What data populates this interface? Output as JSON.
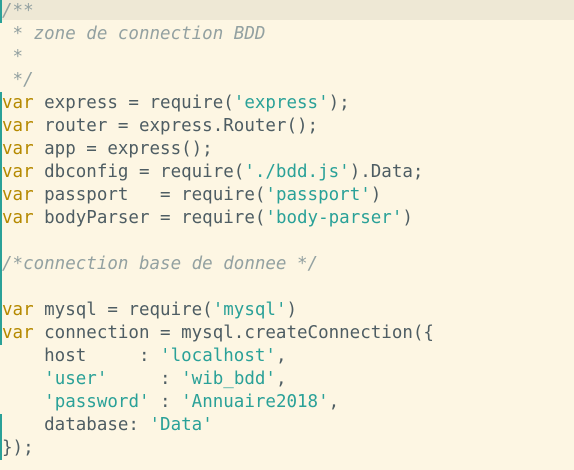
{
  "editor": {
    "theme_colors": {
      "background": "#fdf6e3",
      "keyword": "#b58900",
      "string": "#2aa198",
      "comment": "#93a1a1",
      "text": "#4e5d63"
    },
    "lines": [
      {
        "parts": [
          {
            "t": "cm",
            "v": "/**"
          }
        ]
      },
      {
        "parts": [
          {
            "t": "cm",
            "v": " * zone de connection BDD"
          }
        ]
      },
      {
        "parts": [
          {
            "t": "cm",
            "v": " *"
          }
        ]
      },
      {
        "parts": [
          {
            "t": "cm",
            "v": " */"
          }
        ]
      },
      {
        "parts": [
          {
            "t": "kw",
            "v": "var"
          },
          {
            "t": "plain",
            "v": " express = require("
          },
          {
            "t": "str",
            "v": "'express'"
          },
          {
            "t": "plain",
            "v": ");"
          }
        ]
      },
      {
        "parts": [
          {
            "t": "kw",
            "v": "var"
          },
          {
            "t": "plain",
            "v": " router = express.Router();"
          }
        ]
      },
      {
        "parts": [
          {
            "t": "kw",
            "v": "var"
          },
          {
            "t": "plain",
            "v": " app = express();"
          }
        ]
      },
      {
        "parts": [
          {
            "t": "kw",
            "v": "var"
          },
          {
            "t": "plain",
            "v": " dbconfig = require("
          },
          {
            "t": "str",
            "v": "'./bdd.js'"
          },
          {
            "t": "plain",
            "v": ").Data;"
          }
        ]
      },
      {
        "parts": [
          {
            "t": "kw",
            "v": "var"
          },
          {
            "t": "plain",
            "v": " passport   = require("
          },
          {
            "t": "str",
            "v": "'passport'"
          },
          {
            "t": "plain",
            "v": ")"
          }
        ]
      },
      {
        "parts": [
          {
            "t": "kw",
            "v": "var"
          },
          {
            "t": "plain",
            "v": " bodyParser = require("
          },
          {
            "t": "str",
            "v": "'body-parser'"
          },
          {
            "t": "plain",
            "v": ")"
          }
        ]
      },
      {
        "parts": []
      },
      {
        "parts": [
          {
            "t": "cm",
            "v": "/*connection base de donnee */"
          }
        ]
      },
      {
        "parts": []
      },
      {
        "parts": [
          {
            "t": "kw",
            "v": "var"
          },
          {
            "t": "plain",
            "v": " mysql = require("
          },
          {
            "t": "str",
            "v": "'mysql'"
          },
          {
            "t": "plain",
            "v": ")"
          }
        ]
      },
      {
        "parts": [
          {
            "t": "kw",
            "v": "var"
          },
          {
            "t": "plain",
            "v": " connection = mysql.createConnection({"
          }
        ]
      },
      {
        "parts": [
          {
            "t": "plain",
            "v": "    host     : "
          },
          {
            "t": "str",
            "v": "'localhost'"
          },
          {
            "t": "plain",
            "v": ","
          }
        ]
      },
      {
        "parts": [
          {
            "t": "plain",
            "v": "    "
          },
          {
            "t": "str",
            "v": "'user'"
          },
          {
            "t": "plain",
            "v": "     : "
          },
          {
            "t": "str",
            "v": "'wib_bdd'"
          },
          {
            "t": "plain",
            "v": ","
          }
        ]
      },
      {
        "parts": [
          {
            "t": "plain",
            "v": "    "
          },
          {
            "t": "str",
            "v": "'password'"
          },
          {
            "t": "plain",
            "v": " : "
          },
          {
            "t": "str",
            "v": "'Annuaire2018'"
          },
          {
            "t": "plain",
            "v": ","
          }
        ]
      },
      {
        "parts": [
          {
            "t": "plain",
            "v": "    database: "
          },
          {
            "t": "str",
            "v": "'Data'"
          }
        ]
      },
      {
        "parts": [
          {
            "t": "plain",
            "v": "});"
          }
        ]
      }
    ]
  }
}
